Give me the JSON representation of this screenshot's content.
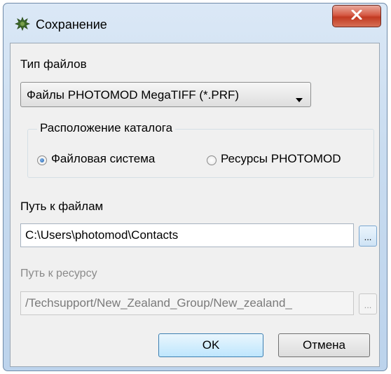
{
  "window": {
    "title": "Сохранение",
    "close_label": "x"
  },
  "file_type": {
    "label": "Тип файлов",
    "selected": "Файлы PHOTOMOD MegaTIFF (*.PRF)"
  },
  "catalog_location": {
    "legend": "Расположение каталога",
    "options": [
      {
        "label": "Файловая система",
        "checked": true
      },
      {
        "label": "Ресурсы PHOTOMOD",
        "checked": false
      }
    ]
  },
  "file_path": {
    "label": "Путь к файлам",
    "value": "C:\\Users\\photomod\\Contacts",
    "browse_label": "..."
  },
  "resource_path": {
    "label": "Путь к ресурсу",
    "value": "/Techsupport/New_Zealand_Group/New_zealand_",
    "browse_label": "..."
  },
  "buttons": {
    "ok": "OK",
    "cancel": "Отмена"
  }
}
